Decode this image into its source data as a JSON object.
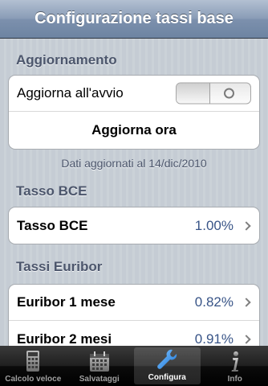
{
  "navbar": {
    "title": "Configurazione tassi base"
  },
  "sections": {
    "aggiornamento": {
      "header": "Aggiornamento",
      "toggle_label": "Aggiorna all'avvio",
      "toggle_state": "off",
      "update_button": "Aggiorna ora",
      "footer": "Dati aggiornati al 14/dic/2010"
    },
    "bce": {
      "header": "Tasso BCE",
      "row": {
        "label": "Tasso BCE",
        "value": "1.00%"
      }
    },
    "euribor": {
      "header": "Tassi Euribor",
      "rows": [
        {
          "label": "Euribor 1 mese",
          "value": "0.82%"
        },
        {
          "label": "Euribor 2 mesi",
          "value": "0.91%"
        }
      ]
    }
  },
  "tabbar": {
    "active": "Configura",
    "tabs": [
      {
        "label": "Calcolo veloce",
        "icon": "calculator-icon"
      },
      {
        "label": "Salvataggi",
        "icon": "calendar-icon"
      },
      {
        "label": "Configura",
        "icon": "wrench-icon"
      },
      {
        "label": "Info",
        "icon": "info-icon"
      }
    ]
  }
}
